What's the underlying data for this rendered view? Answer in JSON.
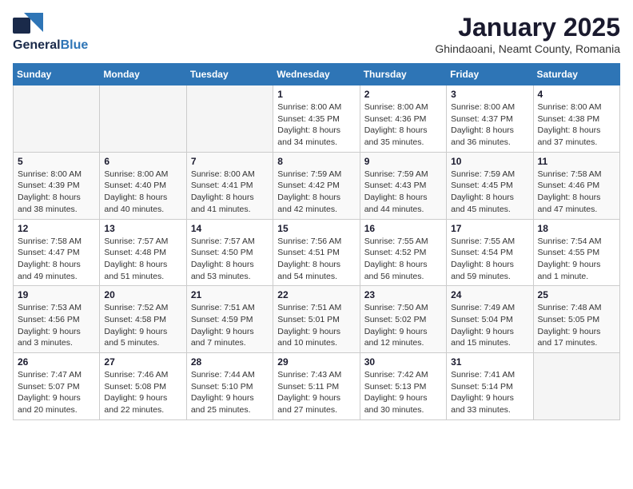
{
  "header": {
    "logo_general": "General",
    "logo_blue": "Blue",
    "month_title": "January 2025",
    "subtitle": "Ghindaoani, Neamt County, Romania"
  },
  "weekdays": [
    "Sunday",
    "Monday",
    "Tuesday",
    "Wednesday",
    "Thursday",
    "Friday",
    "Saturday"
  ],
  "weeks": [
    [
      {
        "day": "",
        "info": ""
      },
      {
        "day": "",
        "info": ""
      },
      {
        "day": "",
        "info": ""
      },
      {
        "day": "1",
        "info": "Sunrise: 8:00 AM\nSunset: 4:35 PM\nDaylight: 8 hours\nand 34 minutes."
      },
      {
        "day": "2",
        "info": "Sunrise: 8:00 AM\nSunset: 4:36 PM\nDaylight: 8 hours\nand 35 minutes."
      },
      {
        "day": "3",
        "info": "Sunrise: 8:00 AM\nSunset: 4:37 PM\nDaylight: 8 hours\nand 36 minutes."
      },
      {
        "day": "4",
        "info": "Sunrise: 8:00 AM\nSunset: 4:38 PM\nDaylight: 8 hours\nand 37 minutes."
      }
    ],
    [
      {
        "day": "5",
        "info": "Sunrise: 8:00 AM\nSunset: 4:39 PM\nDaylight: 8 hours\nand 38 minutes."
      },
      {
        "day": "6",
        "info": "Sunrise: 8:00 AM\nSunset: 4:40 PM\nDaylight: 8 hours\nand 40 minutes."
      },
      {
        "day": "7",
        "info": "Sunrise: 8:00 AM\nSunset: 4:41 PM\nDaylight: 8 hours\nand 41 minutes."
      },
      {
        "day": "8",
        "info": "Sunrise: 7:59 AM\nSunset: 4:42 PM\nDaylight: 8 hours\nand 42 minutes."
      },
      {
        "day": "9",
        "info": "Sunrise: 7:59 AM\nSunset: 4:43 PM\nDaylight: 8 hours\nand 44 minutes."
      },
      {
        "day": "10",
        "info": "Sunrise: 7:59 AM\nSunset: 4:45 PM\nDaylight: 8 hours\nand 45 minutes."
      },
      {
        "day": "11",
        "info": "Sunrise: 7:58 AM\nSunset: 4:46 PM\nDaylight: 8 hours\nand 47 minutes."
      }
    ],
    [
      {
        "day": "12",
        "info": "Sunrise: 7:58 AM\nSunset: 4:47 PM\nDaylight: 8 hours\nand 49 minutes."
      },
      {
        "day": "13",
        "info": "Sunrise: 7:57 AM\nSunset: 4:48 PM\nDaylight: 8 hours\nand 51 minutes."
      },
      {
        "day": "14",
        "info": "Sunrise: 7:57 AM\nSunset: 4:50 PM\nDaylight: 8 hours\nand 53 minutes."
      },
      {
        "day": "15",
        "info": "Sunrise: 7:56 AM\nSunset: 4:51 PM\nDaylight: 8 hours\nand 54 minutes."
      },
      {
        "day": "16",
        "info": "Sunrise: 7:55 AM\nSunset: 4:52 PM\nDaylight: 8 hours\nand 56 minutes."
      },
      {
        "day": "17",
        "info": "Sunrise: 7:55 AM\nSunset: 4:54 PM\nDaylight: 8 hours\nand 59 minutes."
      },
      {
        "day": "18",
        "info": "Sunrise: 7:54 AM\nSunset: 4:55 PM\nDaylight: 9 hours\nand 1 minute."
      }
    ],
    [
      {
        "day": "19",
        "info": "Sunrise: 7:53 AM\nSunset: 4:56 PM\nDaylight: 9 hours\nand 3 minutes."
      },
      {
        "day": "20",
        "info": "Sunrise: 7:52 AM\nSunset: 4:58 PM\nDaylight: 9 hours\nand 5 minutes."
      },
      {
        "day": "21",
        "info": "Sunrise: 7:51 AM\nSunset: 4:59 PM\nDaylight: 9 hours\nand 7 minutes."
      },
      {
        "day": "22",
        "info": "Sunrise: 7:51 AM\nSunset: 5:01 PM\nDaylight: 9 hours\nand 10 minutes."
      },
      {
        "day": "23",
        "info": "Sunrise: 7:50 AM\nSunset: 5:02 PM\nDaylight: 9 hours\nand 12 minutes."
      },
      {
        "day": "24",
        "info": "Sunrise: 7:49 AM\nSunset: 5:04 PM\nDaylight: 9 hours\nand 15 minutes."
      },
      {
        "day": "25",
        "info": "Sunrise: 7:48 AM\nSunset: 5:05 PM\nDaylight: 9 hours\nand 17 minutes."
      }
    ],
    [
      {
        "day": "26",
        "info": "Sunrise: 7:47 AM\nSunset: 5:07 PM\nDaylight: 9 hours\nand 20 minutes."
      },
      {
        "day": "27",
        "info": "Sunrise: 7:46 AM\nSunset: 5:08 PM\nDaylight: 9 hours\nand 22 minutes."
      },
      {
        "day": "28",
        "info": "Sunrise: 7:44 AM\nSunset: 5:10 PM\nDaylight: 9 hours\nand 25 minutes."
      },
      {
        "day": "29",
        "info": "Sunrise: 7:43 AM\nSunset: 5:11 PM\nDaylight: 9 hours\nand 27 minutes."
      },
      {
        "day": "30",
        "info": "Sunrise: 7:42 AM\nSunset: 5:13 PM\nDaylight: 9 hours\nand 30 minutes."
      },
      {
        "day": "31",
        "info": "Sunrise: 7:41 AM\nSunset: 5:14 PM\nDaylight: 9 hours\nand 33 minutes."
      },
      {
        "day": "",
        "info": ""
      }
    ]
  ]
}
